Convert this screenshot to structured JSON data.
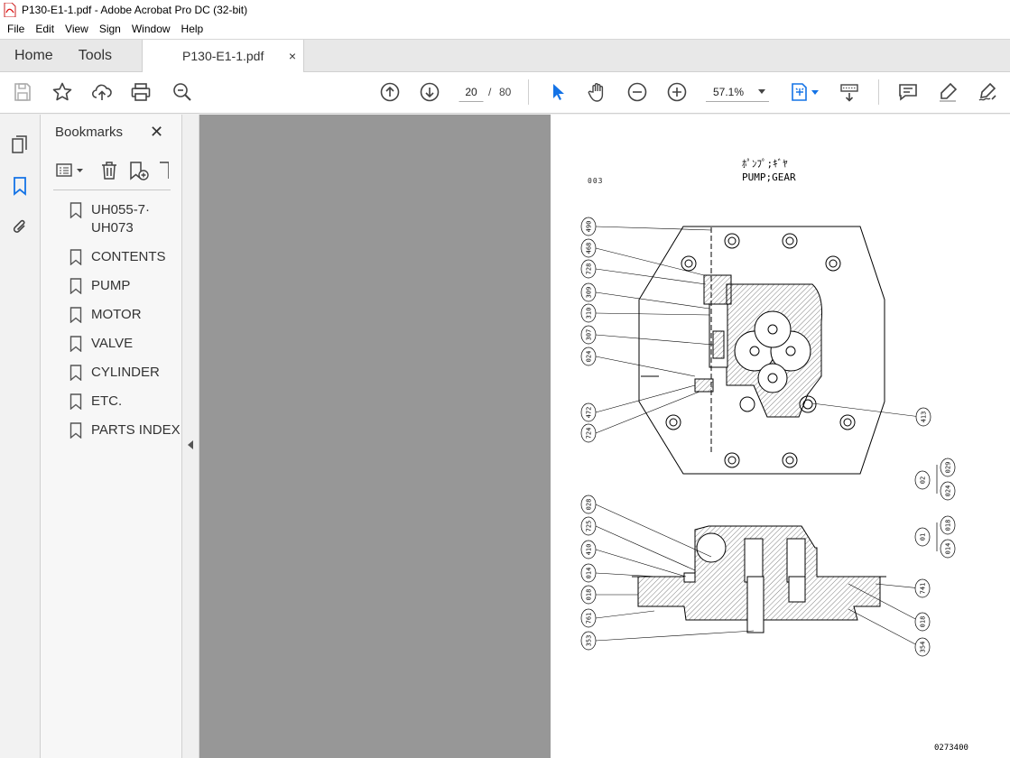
{
  "window": {
    "title": "P130-E1-1.pdf - Adobe Acrobat Pro DC (32-bit)"
  },
  "menu": [
    "File",
    "Edit",
    "View",
    "Sign",
    "Window",
    "Help"
  ],
  "tabs": {
    "home": "Home",
    "tools": "Tools",
    "document": "P130-E1-1.pdf",
    "close": "×"
  },
  "toolbar": {
    "current_page": "20",
    "page_sep": "/",
    "total_pages": "80",
    "zoom": "57.1%",
    "icons": [
      "save-icon",
      "star-icon",
      "upload-icon",
      "print-icon",
      "zoom-search-icon",
      "page-up-icon",
      "page-down-icon",
      "select-cursor-icon",
      "hand-icon",
      "zoom-out-icon",
      "zoom-in-icon",
      "fit-page-icon",
      "scroll-mode-icon",
      "comment-icon",
      "highlight-icon",
      "sign-icon"
    ]
  },
  "bookmarks": {
    "title": "Bookmarks",
    "close": "✕",
    "items": [
      {
        "line1": "UH055-7·",
        "line2": "UH073"
      },
      {
        "line1": "CONTENTS"
      },
      {
        "line1": "PUMP"
      },
      {
        "line1": "MOTOR"
      },
      {
        "line1": "VALVE"
      },
      {
        "line1": "CYLINDER"
      },
      {
        "line1": "ETC."
      },
      {
        "line1": "PARTS INDEX"
      }
    ]
  },
  "page": {
    "jp_title": "ﾎﾟﾝﾌﾟ;ｷﾞﾔ",
    "en_title": "PUMP;GEAR",
    "code": "003",
    "drawing_number": "0273400",
    "callouts_left_top": [
      "490",
      "468",
      "728",
      "309",
      "310",
      "307",
      "024",
      "472",
      "724"
    ],
    "callout_right_top": "413",
    "callouts_left_bottom": [
      "028",
      "725",
      "410",
      "014",
      "018",
      "761",
      "353"
    ],
    "callouts_right_bottom": [
      "741",
      "018",
      "354"
    ],
    "group_02": {
      "label": "02",
      "items": [
        "029",
        "024"
      ]
    },
    "group_01": {
      "label": "01",
      "items": [
        "018",
        "014"
      ]
    }
  }
}
